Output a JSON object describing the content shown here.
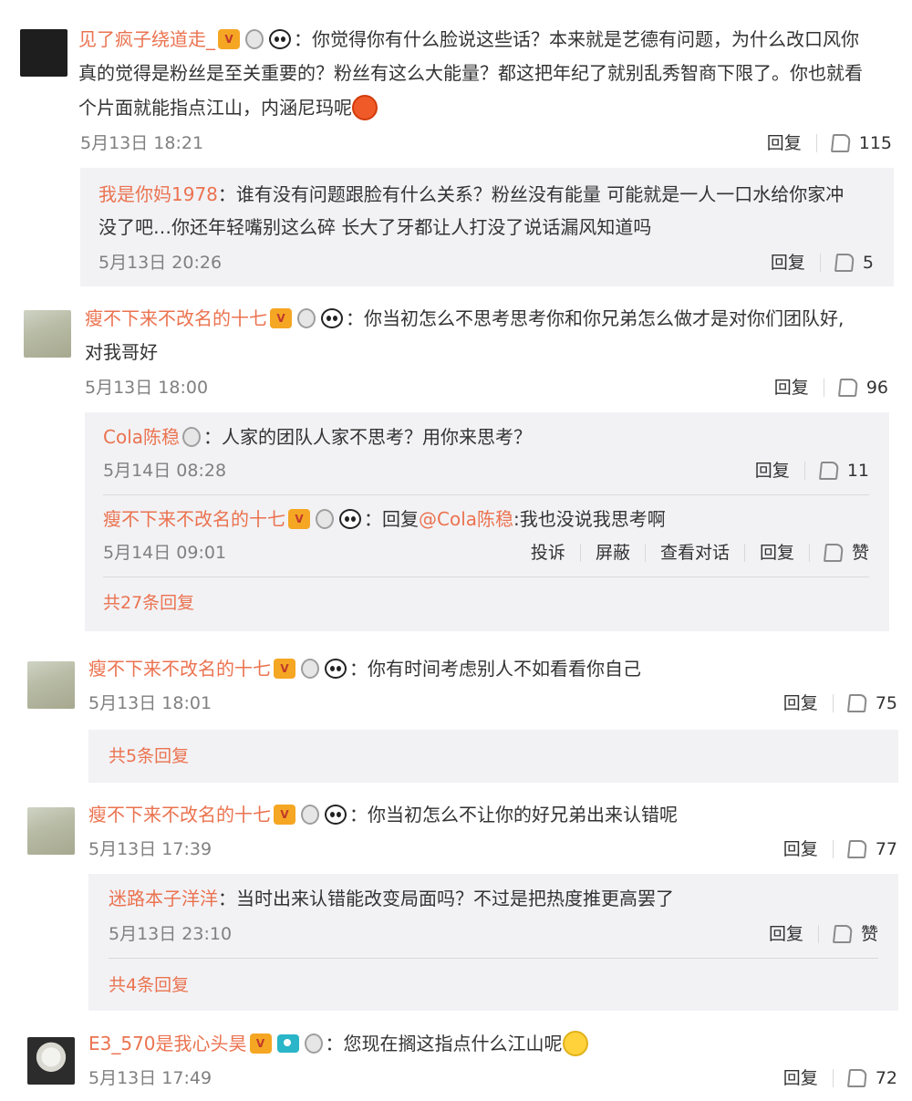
{
  "labels": {
    "reply": "回复",
    "report": "投诉",
    "block": "屏蔽",
    "view_conversation": "查看对话",
    "like": "赞"
  },
  "comments": [
    {
      "user": "见了疯子绕道走_",
      "text_line1": "你觉得你有什么脸说这些话？本来就是艺德有问题，为什么改口风你",
      "text_line2": "真的觉得是粉丝是至关重要的？粉丝有这么大能量？都这把年纪了就别乱秀智商下限了。你也就看",
      "text_line3": "个片面就能指点江山，内涵尼玛呢",
      "time": "5月13日 18:21",
      "likes": "115",
      "replies": [
        {
          "user": "我是你妈1978",
          "text_line1": "谁有没有问题跟脸有什么关系？粉丝没有能量 可能就是一人一口水给你家冲",
          "text_line2": "没了吧…你还年轻嘴别这么碎 长大了牙都让人打没了说话漏风知道吗",
          "time": "5月13日 20:26",
          "likes": "5"
        }
      ]
    },
    {
      "user": "瘦不下来不改名的十七",
      "text_line1": "你当初怎么不思考思考你和你兄弟怎么做才是对你们团队好,",
      "text_line2": "对我哥好",
      "time": "5月13日 18:00",
      "likes": "96",
      "replies": [
        {
          "user": "Cola陈稳",
          "text": "人家的团队人家不思考？用你来思考？",
          "time": "5月14日 08:28",
          "likes": "11"
        },
        {
          "user": "瘦不下来不改名的十七",
          "reply_prefix": "回复",
          "mention": "@Cola陈稳",
          "text": ":我也没说我思考啊",
          "time": "5月14日 09:01"
        }
      ],
      "more": "共27条回复"
    },
    {
      "user": "瘦不下来不改名的十七",
      "text": "你有时间考虑别人不如看看你自己",
      "time": "5月13日 18:01",
      "likes": "75",
      "more": "共5条回复"
    },
    {
      "user": "瘦不下来不改名的十七",
      "text": "你当初怎么不让你的好兄弟出来认错呢",
      "time": "5月13日 17:39",
      "likes": "77",
      "replies": [
        {
          "user": "迷路本子洋洋",
          "text": "当时出来认错能改变局面吗？不过是把热度推更高罢了",
          "time": "5月13日 23:10"
        }
      ],
      "more": "共4条回复"
    },
    {
      "user": "E3_570是我心头昊",
      "text": "您现在搁这指点什么江山呢",
      "time": "5月13日 17:49",
      "likes": "72"
    }
  ],
  "colors": {
    "username": "#eb7350",
    "subpanel": "#f2f2f5",
    "meta": "#808080"
  },
  "icons": [
    "vip-icon",
    "medal-icon",
    "panda-icon",
    "camera-icon",
    "like-icon",
    "angry-emoji-icon",
    "smile-emoji-icon"
  ]
}
